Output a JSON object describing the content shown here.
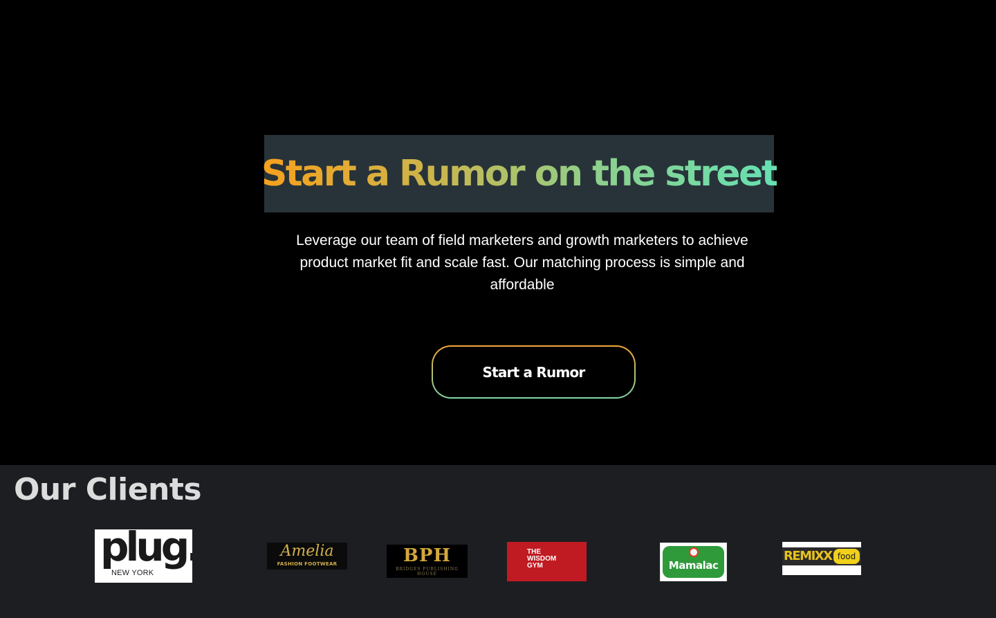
{
  "hero": {
    "headline": "Start a Rumor on the street",
    "subtext": "Leverage our team of field marketers and growth marketers to achieve product market fit and scale fast. Our matching process is simple and affordable",
    "cta_label": "Start a Rumor"
  },
  "clients": {
    "title": "Our Clients",
    "logos": [
      {
        "word": "plug.",
        "sub": "NEW YORK"
      },
      {
        "word": "Amelia",
        "sub": "FASHION FOOTWEAR"
      },
      {
        "word": "BPH",
        "sub": "BRIDGES PUBLISHING HOUSE"
      },
      {
        "word": "THE\nWISDOM\nGYM"
      },
      {
        "word": "Mamalac"
      },
      {
        "word": "REMIXX",
        "sub": "food"
      }
    ]
  },
  "colors": {
    "background": "#000000",
    "headline_box": "#283339",
    "gradient_start": "#f7a11c",
    "gradient_end": "#66e0b3",
    "clients_background": "#1c1e22"
  }
}
